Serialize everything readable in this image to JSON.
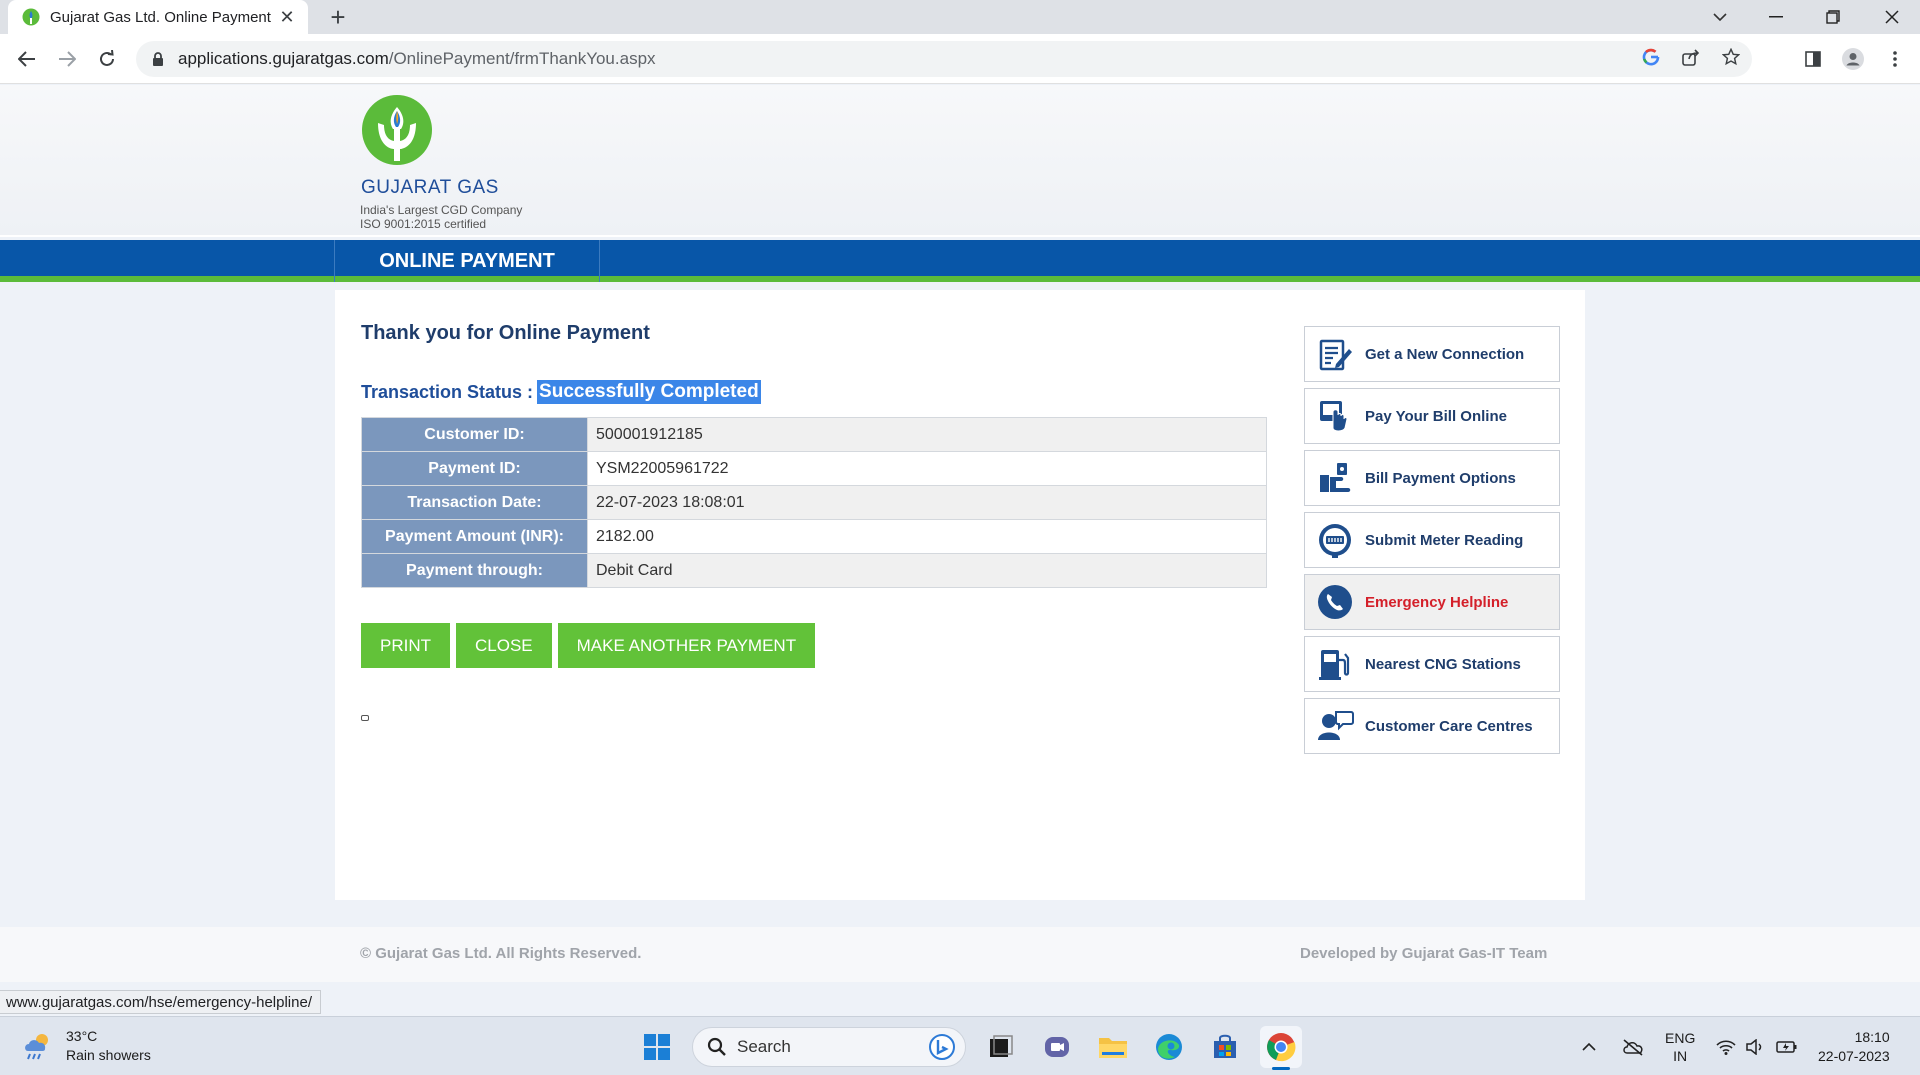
{
  "browser": {
    "tab_title": "Gujarat Gas Ltd. Online Payment",
    "url_host": "applications.gujaratgas.com",
    "url_path": "/OnlinePayment/frmThankYou.aspx",
    "status_url": "www.gujaratgas.com/hse/emergency-helpline/"
  },
  "header": {
    "brand": "GUJARAT GAS",
    "tagline_1": "India's Largest CGD Company",
    "tagline_2": "ISO 9001:2015 certified",
    "nav_item": "ONLINE PAYMENT"
  },
  "main": {
    "title": "Thank you for Online Payment",
    "status_label": "Transaction Status :",
    "status_value": "Successfully Completed",
    "rows": [
      {
        "label": "Customer ID:",
        "value": "500001912185"
      },
      {
        "label": "Payment ID:",
        "value": "YSM22005961722"
      },
      {
        "label": "Transaction Date:",
        "value": "22-07-2023 18:08:01"
      },
      {
        "label": "Payment Amount (INR):",
        "value": "2182.00"
      },
      {
        "label": "Payment through:",
        "value": "Debit Card"
      }
    ],
    "buttons": {
      "print": "PRINT",
      "close": "CLOSE",
      "another": "MAKE ANOTHER PAYMENT"
    }
  },
  "sidebar": {
    "items": [
      {
        "label": "Get a New Connection",
        "icon": "form-icon"
      },
      {
        "label": "Pay Your Bill Online",
        "icon": "pay-online-icon"
      },
      {
        "label": "Bill Payment Options",
        "icon": "bill-options-icon"
      },
      {
        "label": "Submit Meter Reading",
        "icon": "meter-icon"
      },
      {
        "label": "Emergency Helpline",
        "icon": "phone-icon"
      },
      {
        "label": "Nearest CNG Stations",
        "icon": "fuel-pump-icon"
      },
      {
        "label": "Customer Care Centres",
        "icon": "customer-care-icon"
      }
    ]
  },
  "footer": {
    "copyright": "© Gujarat Gas Ltd.  All Rights Reserved.",
    "developed": "Developed by Gujarat Gas-IT Team"
  },
  "taskbar": {
    "temperature": "33°C",
    "weather": "Rain showers",
    "search_placeholder": "Search",
    "lang_1": "ENG",
    "lang_2": "IN",
    "time": "18:10",
    "date": "22-07-2023"
  },
  "colors": {
    "brand_blue": "#0856a8",
    "accent_green": "#62c239",
    "highlight_red": "#d4202a",
    "label_blue": "#7b97bd"
  }
}
